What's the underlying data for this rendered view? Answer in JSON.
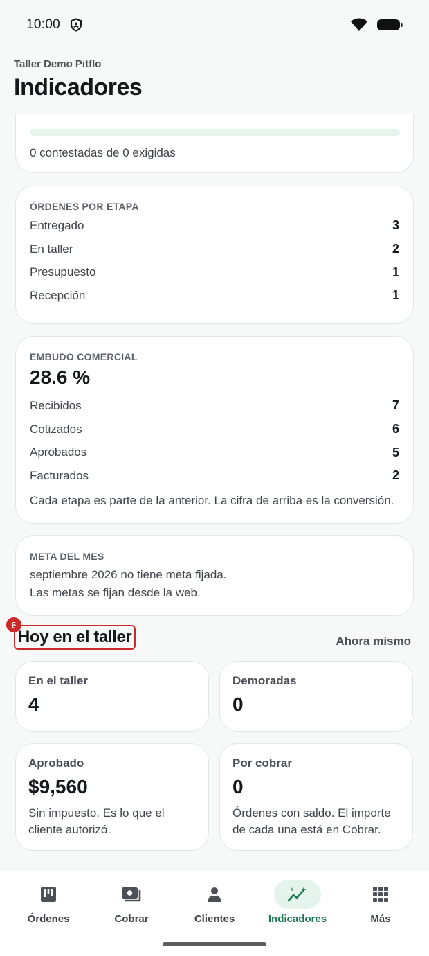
{
  "status": {
    "time": "10:00"
  },
  "header": {
    "workshop": "Taller Demo Pitflo",
    "title": "Indicadores"
  },
  "survey": {
    "progress_fraction": 0,
    "text": "0 contestadas de 0 exigidas"
  },
  "orders_by_stage": {
    "label": "ÓRDENES POR ETAPA",
    "rows": [
      {
        "name": "Entregado",
        "value": "3"
      },
      {
        "name": "En taller",
        "value": "2"
      },
      {
        "name": "Presupuesto",
        "value": "1"
      },
      {
        "name": "Recepción",
        "value": "1"
      }
    ]
  },
  "funnel": {
    "label": "EMBUDO COMERCIAL",
    "conversion": "28.6 %",
    "rows": [
      {
        "name": "Recibidos",
        "value": "7"
      },
      {
        "name": "Cotizados",
        "value": "6"
      },
      {
        "name": "Aprobados",
        "value": "5"
      },
      {
        "name": "Facturados",
        "value": "2"
      }
    ],
    "note": "Cada etapa es parte de la anterior. La cifra de arriba es la conversión."
  },
  "goal": {
    "label": "META DEL MES",
    "line1": "septiembre 2026 no tiene meta fijada.",
    "line2": "Las metas se fijan desde la web."
  },
  "today": {
    "badge": "6",
    "title": "Hoy en el taller",
    "aside": "Ahora mismo",
    "tiles": [
      {
        "label": "En el taller",
        "value": "4",
        "note": ""
      },
      {
        "label": "Demoradas",
        "value": "0",
        "note": ""
      },
      {
        "label": "Aprobado",
        "value": "$9,560",
        "note": "Sin impuesto. Es lo que el cliente autorizó."
      },
      {
        "label": "Por cobrar",
        "value": "0",
        "note": "Órdenes con saldo. El importe de cada una está en Cobrar."
      }
    ]
  },
  "nav": {
    "items": [
      {
        "label": "Órdenes",
        "icon": "kanban-icon"
      },
      {
        "label": "Cobrar",
        "icon": "cash-icon"
      },
      {
        "label": "Clientes",
        "icon": "person-icon"
      },
      {
        "label": "Indicadores",
        "icon": "trend-icon"
      },
      {
        "label": "Más",
        "icon": "grid-icon"
      }
    ],
    "active": "Indicadores"
  }
}
